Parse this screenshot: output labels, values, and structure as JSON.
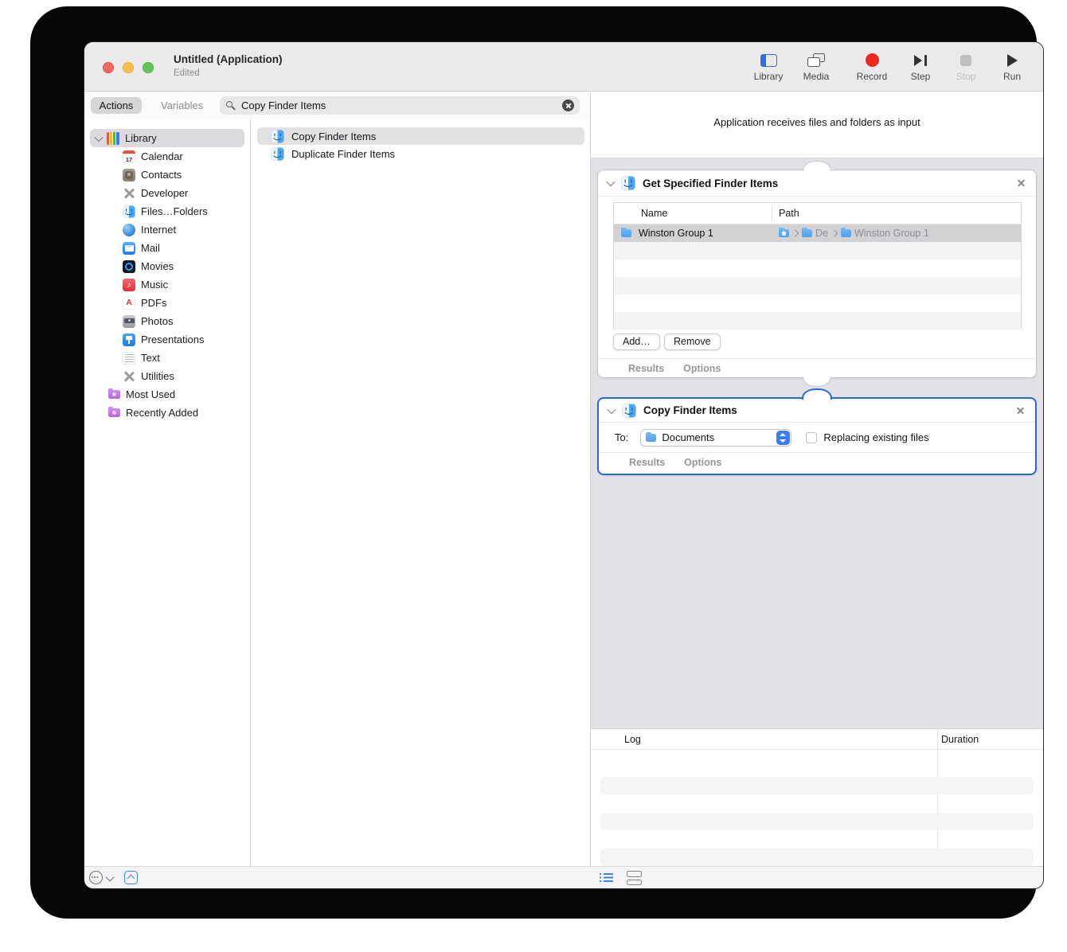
{
  "window": {
    "title": "Untitled (Application)",
    "status": "Edited"
  },
  "toolbar": {
    "items": [
      {
        "label": "Library"
      },
      {
        "label": "Media"
      },
      {
        "label": "Record"
      },
      {
        "label": "Step"
      },
      {
        "label": "Stop"
      },
      {
        "label": "Run"
      }
    ]
  },
  "tabs": {
    "actions": "Actions",
    "variables": "Variables"
  },
  "search": {
    "value": "Copy Finder Items"
  },
  "sidebar": {
    "items": [
      {
        "label": "Library"
      },
      {
        "label": "Calendar"
      },
      {
        "label": "Contacts"
      },
      {
        "label": "Developer"
      },
      {
        "label": "Files…Folders"
      },
      {
        "label": "Internet"
      },
      {
        "label": "Mail"
      },
      {
        "label": "Movies"
      },
      {
        "label": "Music"
      },
      {
        "label": "PDFs"
      },
      {
        "label": "Photos"
      },
      {
        "label": "Presentations"
      },
      {
        "label": "Text"
      },
      {
        "label": "Utilities"
      },
      {
        "label": "Most Used"
      },
      {
        "label": "Recently Added"
      }
    ]
  },
  "action_list": {
    "items": [
      {
        "label": "Copy Finder Items"
      },
      {
        "label": "Duplicate Finder Items"
      }
    ]
  },
  "canvas": {
    "caption": "Application receives files and folders as input",
    "block1": {
      "title": "Get Specified Finder Items",
      "col_name": "Name",
      "col_path": "Path",
      "row_name": "Winston Group 1",
      "path_folder": "De",
      "path_item": "Winston Group 1",
      "add_label": "Add…",
      "remove_label": "Remove",
      "results": "Results",
      "options": "Options"
    },
    "block2": {
      "title": "Copy Finder Items",
      "to_label": "To:",
      "to_value": "Documents",
      "checkbox_label": "Replacing existing files",
      "results": "Results",
      "options": "Options"
    }
  },
  "log": {
    "col_log": "Log",
    "col_duration": "Duration"
  },
  "colors": {
    "selection_blue": "#2667e8",
    "record_red": "#ee281c",
    "canvas_background": "#e4e1e6",
    "folder_blue": "#4d9ef0",
    "smart_folder_purple": "#b465e0"
  }
}
